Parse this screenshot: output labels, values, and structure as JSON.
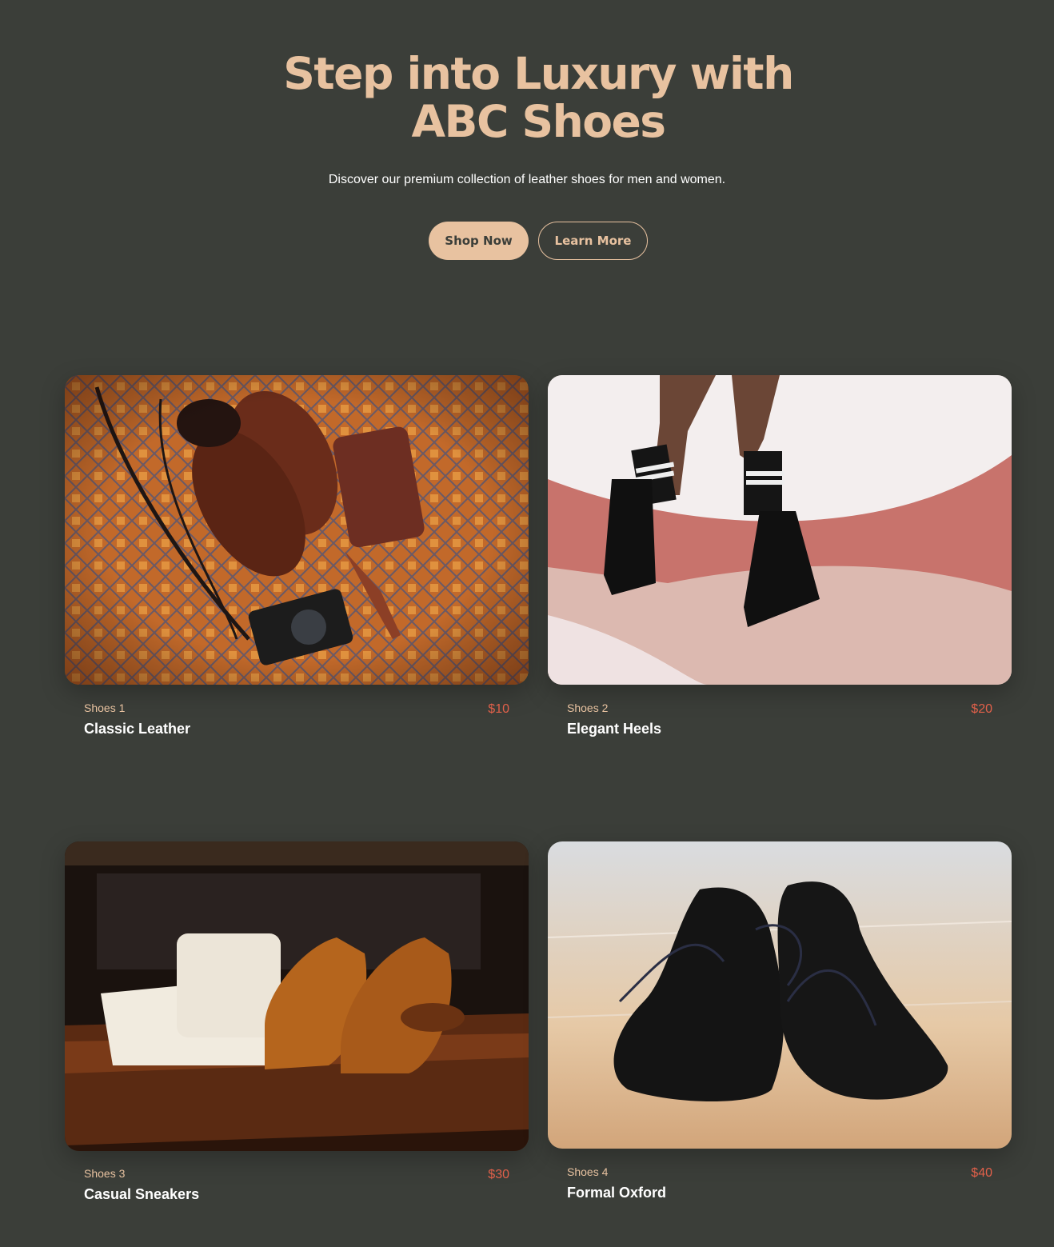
{
  "hero": {
    "title": "Step into Luxury with ABC Shoes",
    "subtitle": "Discover our premium collection of leather shoes for men and women.",
    "primary_button": "Shop Now",
    "secondary_button": "Learn More"
  },
  "products": [
    {
      "category": "Shoes 1",
      "name": "Classic Leather",
      "price": "$10",
      "image_icon": "leather-boots-flatlay-image"
    },
    {
      "category": "Shoes 2",
      "name": "Elegant Heels",
      "price": "$20",
      "image_icon": "black-boots-on-bed-image"
    },
    {
      "category": "Shoes 3",
      "name": "Casual Sneakers",
      "price": "$30",
      "image_icon": "tan-oxfords-on-table-image"
    },
    {
      "category": "Shoes 4",
      "name": "Formal Oxford",
      "price": "$40",
      "image_icon": "black-oxfords-on-floor-image"
    }
  ],
  "colors": {
    "background": "#3b3e39",
    "accent": "#e8c2a0",
    "price": "#e0604a"
  }
}
